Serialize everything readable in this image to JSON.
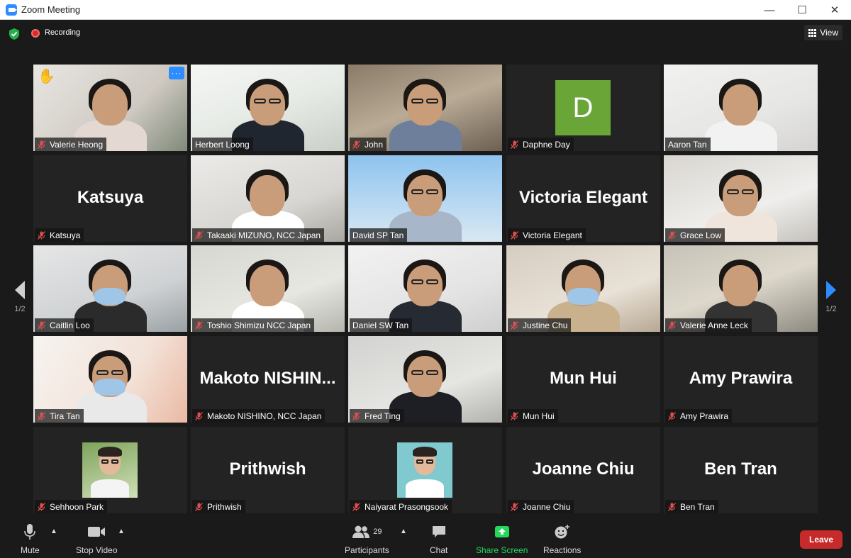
{
  "window": {
    "title": "Zoom Meeting"
  },
  "topbar": {
    "recording_label": "Recording",
    "view_label": "View"
  },
  "pagination": {
    "left": "1/2",
    "right": "1/2"
  },
  "tiles": [
    {
      "name": "Valerie Heong",
      "type": "video",
      "muted": true,
      "raised_hand": true,
      "more": "···"
    },
    {
      "name": "Herbert Loong",
      "type": "video",
      "muted": false
    },
    {
      "name": "John",
      "type": "video",
      "muted": true
    },
    {
      "name": "Daphne Day",
      "type": "avatar",
      "initial": "D",
      "muted": true
    },
    {
      "name": "Aaron Tan",
      "type": "video",
      "muted": false
    },
    {
      "name": "Katsuya",
      "type": "name",
      "muted": true
    },
    {
      "name": "Takaaki MIZUNO, NCC Japan",
      "type": "video",
      "muted": true
    },
    {
      "name": "David SP Tan",
      "type": "video",
      "muted": false,
      "active": true
    },
    {
      "name": "Victoria Elegant",
      "type": "name",
      "muted": true
    },
    {
      "name": "Grace Low",
      "type": "video",
      "muted": true
    },
    {
      "name": "Caitlin Loo",
      "type": "video",
      "muted": true
    },
    {
      "name": "Toshio Shimizu NCC Japan",
      "type": "video",
      "muted": true
    },
    {
      "name": "Daniel SW Tan",
      "type": "video",
      "muted": false
    },
    {
      "name": "Justine Chu",
      "type": "video",
      "muted": true
    },
    {
      "name": "Valerie Anne Leck",
      "type": "video",
      "muted": true
    },
    {
      "name": "Tira Tan",
      "type": "video",
      "muted": true
    },
    {
      "name": "Makoto NISHINO, NCC Japan",
      "big": "Makoto  NISHIN...",
      "type": "name",
      "muted": true
    },
    {
      "name": "Fred Ting",
      "type": "video",
      "muted": true
    },
    {
      "name": "Mun Hui",
      "type": "name",
      "muted": true
    },
    {
      "name": "Amy Prawira",
      "type": "name",
      "muted": true
    },
    {
      "name": "Sehhoon Park",
      "type": "photo",
      "muted": true
    },
    {
      "name": "Prithwish",
      "type": "name",
      "muted": true
    },
    {
      "name": "Naiyarat Prasongsook",
      "type": "photo",
      "muted": true
    },
    {
      "name": "Joanne Chiu",
      "type": "name",
      "muted": true
    },
    {
      "name": "Ben Tran",
      "type": "name",
      "muted": true
    }
  ],
  "toolbar": {
    "mute_label": "Mute",
    "stop_video_label": "Stop Video",
    "participants_label": "Participants",
    "participants_count": "29",
    "chat_label": "Chat",
    "share_screen_label": "Share Screen",
    "reactions_label": "Reactions",
    "leave_label": "Leave"
  },
  "colors": {
    "accent": "#2d8cff",
    "share": "#23d959",
    "leave": "#c72a2a",
    "active_border": "#d6e35a",
    "avatar_bg": "#6aa637"
  }
}
